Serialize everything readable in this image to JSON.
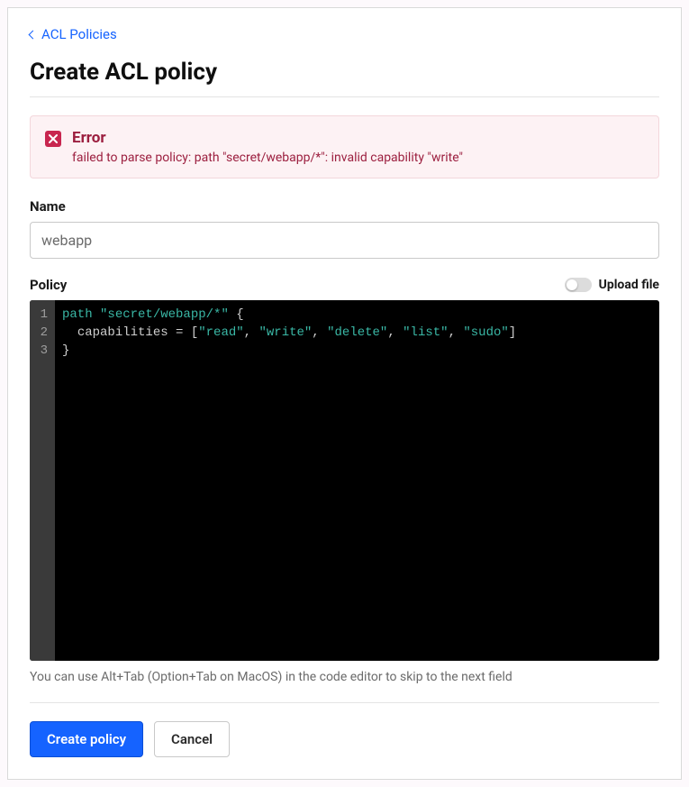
{
  "breadcrumb": {
    "parent_label": "ACL Policies"
  },
  "page": {
    "title": "Create ACL policy"
  },
  "alert": {
    "title": "Error",
    "message": "failed to parse policy: path \"secret/webapp/*\": invalid capability \"write\""
  },
  "form": {
    "name_label": "Name",
    "name_value": "webapp",
    "policy_label": "Policy",
    "upload_file_label": "Upload file",
    "upload_file_enabled": false,
    "helper_text": "You can use Alt+Tab (Option+Tab on MacOS) in the code editor to skip to the next field"
  },
  "code": {
    "lines": [
      {
        "num": "1",
        "segments": [
          {
            "cls": "tok-kw",
            "text": "path "
          },
          {
            "cls": "tok-str",
            "text": "\"secret/webapp/*\""
          },
          {
            "cls": "tok-punc",
            "text": " {"
          }
        ]
      },
      {
        "num": "2",
        "segments": [
          {
            "cls": "tok-punc",
            "text": "  "
          },
          {
            "cls": "tok-id",
            "text": "capabilities"
          },
          {
            "cls": "tok-punc",
            "text": " = ["
          },
          {
            "cls": "tok-str",
            "text": "\"read\""
          },
          {
            "cls": "tok-punc",
            "text": ", "
          },
          {
            "cls": "tok-str",
            "text": "\"write\""
          },
          {
            "cls": "tok-punc",
            "text": ", "
          },
          {
            "cls": "tok-str",
            "text": "\"delete\""
          },
          {
            "cls": "tok-punc",
            "text": ", "
          },
          {
            "cls": "tok-str",
            "text": "\"list\""
          },
          {
            "cls": "tok-punc",
            "text": ", "
          },
          {
            "cls": "tok-str",
            "text": "\"sudo\""
          },
          {
            "cls": "tok-punc",
            "text": "]"
          }
        ]
      },
      {
        "num": "3",
        "segments": [
          {
            "cls": "tok-punc",
            "text": "}"
          }
        ]
      }
    ]
  },
  "buttons": {
    "primary": "Create policy",
    "secondary": "Cancel"
  }
}
